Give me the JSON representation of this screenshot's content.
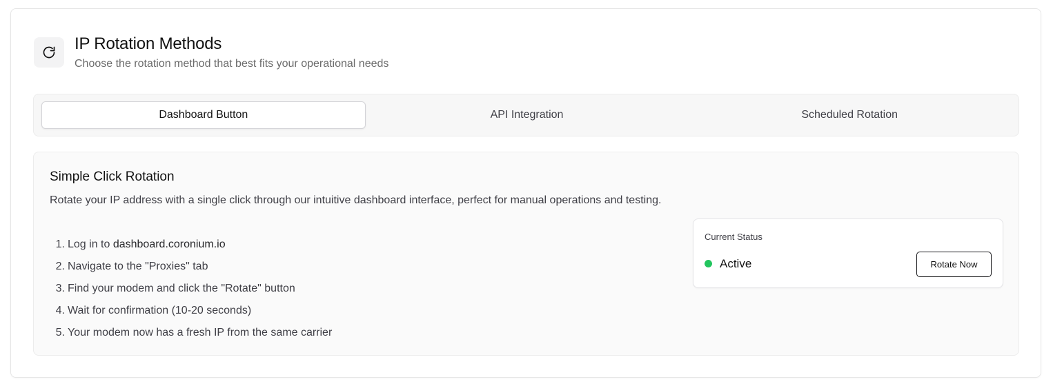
{
  "header": {
    "icon": "refresh-icon",
    "title": "IP Rotation Methods",
    "subtitle": "Choose the rotation method that best fits your operational needs"
  },
  "tabs": [
    {
      "label": "Dashboard Button",
      "active": true
    },
    {
      "label": "API Integration",
      "active": false
    },
    {
      "label": "Scheduled Rotation",
      "active": false
    }
  ],
  "panel": {
    "title": "Simple Click Rotation",
    "description": "Rotate your IP address with a single click through our intuitive dashboard interface, perfect for manual operations and testing.",
    "steps": [
      {
        "num": "1.",
        "pre": "Log in to ",
        "strong": "dashboard.coronium.io",
        "post": ""
      },
      {
        "num": "2.",
        "pre": "Navigate to the \"Proxies\" tab",
        "strong": "",
        "post": ""
      },
      {
        "num": "3.",
        "pre": "Find your modem and click the \"Rotate\" button",
        "strong": "",
        "post": ""
      },
      {
        "num": "4.",
        "pre": "Wait for confirmation (10-20 seconds)",
        "strong": "",
        "post": ""
      },
      {
        "num": "5.",
        "pre": "Your modem now has a fresh IP from the same carrier",
        "strong": "",
        "post": ""
      }
    ]
  },
  "status": {
    "label": "Current Status",
    "value": "Active",
    "dot_color": "#22c55e",
    "button_label": "Rotate Now"
  }
}
